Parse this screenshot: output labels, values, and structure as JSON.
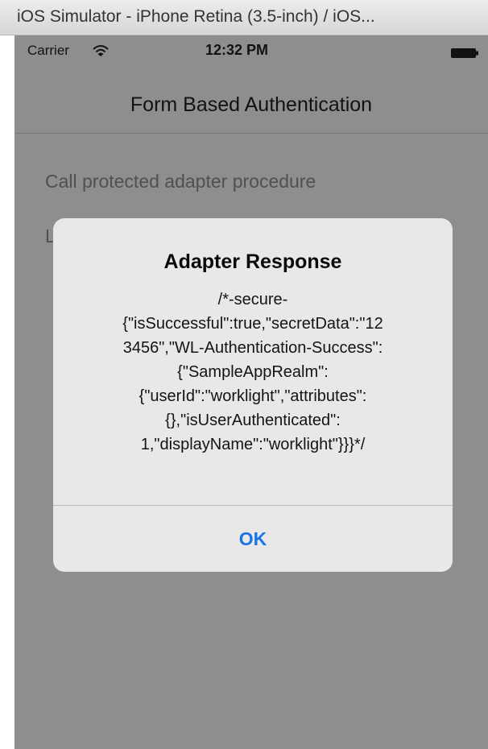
{
  "window": {
    "title": "iOS Simulator - iPhone Retina (3.5-inch) / iOS..."
  },
  "status_bar": {
    "carrier": "Carrier",
    "time": "12:32 PM",
    "wifi_icon": "wifi-icon",
    "battery_icon": "battery-icon"
  },
  "nav_bar": {
    "title": "Form Based Authentication"
  },
  "list": {
    "items": [
      {
        "label": "Call protected adapter procedure"
      },
      {
        "label": "L"
      }
    ]
  },
  "alert": {
    "title": "Adapter Response",
    "message": "/*-secure-\n{\"isSuccessful\":true,\"secretData\":\"12\n3456\",\"WL-Authentication-Success\":\n{\"SampleAppRealm\":\n{\"userId\":\"worklight\",\"attributes\":\n{},\"isUserAuthenticated\":\n1,\"displayName\":\"worklight\"}}}*/",
    "button_label": "OK"
  },
  "colors": {
    "dimmed_background": "#8e8e8e",
    "alert_background": "#e8e8e8",
    "ios_blue": "#1a74e8"
  }
}
